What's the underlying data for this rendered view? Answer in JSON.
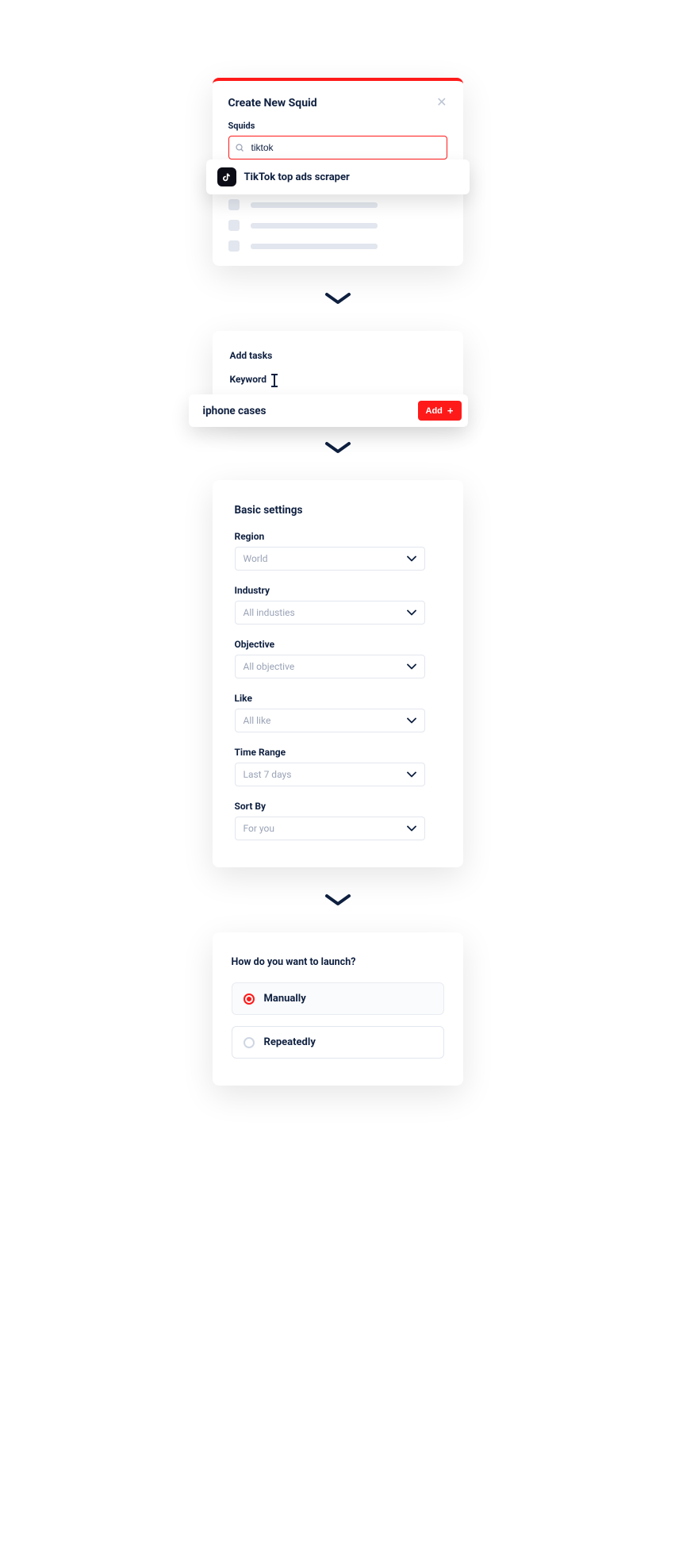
{
  "card1": {
    "title": "Create New Squid",
    "section_label": "Squids",
    "search_value": "tiktok",
    "dropdown_option": "TikTok top ads scraper"
  },
  "card2": {
    "title": "Add tasks",
    "field_label": "Keyword",
    "keyword_value": "iphone cases",
    "add_label": "Add"
  },
  "card3": {
    "title": "Basic settings",
    "fields": [
      {
        "label": "Region",
        "value": "World"
      },
      {
        "label": "Industry",
        "value": "All industies"
      },
      {
        "label": "Objective",
        "value": "All objective"
      },
      {
        "label": "Like",
        "value": "All like"
      },
      {
        "label": "Time Range",
        "value": "Last 7 days"
      },
      {
        "label": "Sort By",
        "value": "For you"
      }
    ]
  },
  "card4": {
    "title": "How do you want to launch?",
    "options": {
      "manual": "Manually",
      "repeated": "Repeatedly"
    }
  }
}
